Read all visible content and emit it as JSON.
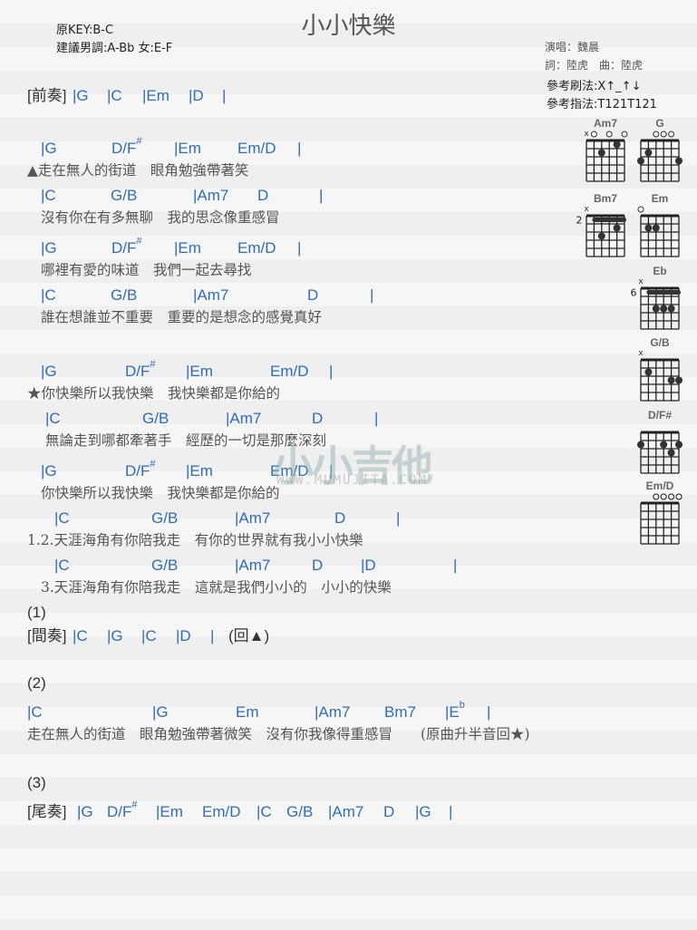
{
  "header": {
    "title": "小小快樂",
    "key": "原KEY:B-C",
    "suggested": "建議男調:A-Bb 女:E-F",
    "singer": "演唱：魏晨",
    "writers": "詞：陸虎　曲：陸虎",
    "strum": "參考刷法:X↑_↑↓",
    "finger": "參考指法:T121T121"
  },
  "colors": {
    "chord": "#2f6db5",
    "lyric": "#555555"
  },
  "watermark": {
    "logo": "小小吉他",
    "url": "WWW.MUMUJITA.COM"
  },
  "lines": [
    {
      "type": "chords",
      "items": [
        {
          "mark": "[前奏]"
        },
        "|G",
        "|C",
        "|Em",
        "|D",
        "|"
      ]
    },
    {
      "type": "chords",
      "items": [
        "|G",
        {
          "c": "D/F",
          "sup": "#"
        },
        "|Em",
        "Em/D",
        "|"
      ]
    },
    {
      "type": "lyric",
      "text": "▲走在無人的街道　眼角勉強帶著笑"
    },
    {
      "type": "chords",
      "items": [
        "|C",
        "G/B",
        "|Am7",
        "D",
        "|"
      ]
    },
    {
      "type": "lyric",
      "text": "沒有你在有多無聊　我的思念像重感冒"
    },
    {
      "type": "chords",
      "items": [
        "|G",
        {
          "c": "D/F",
          "sup": "#"
        },
        "|Em",
        "Em/D",
        "|"
      ]
    },
    {
      "type": "lyric",
      "text": "哪裡有愛的味道　我們一起去尋找"
    },
    {
      "type": "chords",
      "items": [
        "|C",
        "G/B",
        "|Am7",
        "D",
        "|"
      ]
    },
    {
      "type": "lyric",
      "text": "誰在想誰並不重要　重要的是想念的感覺真好"
    },
    {
      "type": "chords",
      "items": [
        "|G",
        {
          "c": "D/F",
          "sup": "#"
        },
        "|Em",
        "Em/D",
        "|"
      ]
    },
    {
      "type": "lyric",
      "text": "★你快樂所以我快樂　我快樂都是你給的"
    },
    {
      "type": "chords",
      "items": [
        "|C",
        "G/B",
        "|Am7",
        "D",
        "|"
      ]
    },
    {
      "type": "lyric",
      "text": "無論走到哪都牽著手　經歷的一切是那麼深刻"
    },
    {
      "type": "chords",
      "items": [
        "|G",
        {
          "c": "D/F",
          "sup": "#"
        },
        "|Em",
        "Em/D",
        "|"
      ]
    },
    {
      "type": "lyric",
      "text": "你快樂所以我快樂　我快樂都是你給的"
    },
    {
      "type": "chords",
      "items": [
        "|C",
        "G/B",
        "|Am7",
        "D",
        "|"
      ]
    },
    {
      "type": "lyric",
      "text": "1.2.天涯海角有你陪我走　有你的世界就有我小小快樂"
    },
    {
      "type": "chords",
      "items": [
        "|C",
        "G/B",
        "|Am7",
        "D",
        "|D",
        "|"
      ]
    },
    {
      "type": "lyric",
      "text": "3.天涯海角有你陪我走　這就是我們小小的　小小的快樂"
    },
    {
      "type": "mark",
      "text": "(1)"
    },
    {
      "type": "chords",
      "items": [
        {
          "mark": "[間奏]"
        },
        "|C",
        "|G",
        "|C",
        "|D",
        "|",
        {
          "mark": "(回▲)"
        }
      ]
    },
    {
      "type": "mark",
      "text": "(2)"
    },
    {
      "type": "chords",
      "items": [
        "|C",
        "|G",
        "Em",
        "|Am7",
        "Bm7",
        {
          "c": "|E",
          "sup": "b"
        },
        "|"
      ]
    },
    {
      "type": "lyric",
      "text": "走在無人的街道　眼角勉強帶著微笑　沒有你我像得重感冒　　(原曲升半音回★)"
    },
    {
      "type": "mark",
      "text": "(3)"
    },
    {
      "type": "chords",
      "items": [
        {
          "mark": "[尾奏]"
        },
        "|G",
        {
          "c": "D/F",
          "sup": "#"
        },
        "|Em",
        "Em/D",
        "|C",
        "G/B",
        "|Am7",
        "D",
        "|G",
        "|"
      ]
    }
  ],
  "diagrams": [
    {
      "name": "Am7",
      "frets": "x02010"
    },
    {
      "name": "G",
      "frets": "320003"
    },
    {
      "name": "Bm7",
      "frets": "x13121",
      "base": "2",
      "barre": 1
    },
    {
      "name": "Em",
      "frets": "022000",
      "openOnly": [
        0
      ]
    },
    {
      "name": "Eb",
      "frets": "x13331",
      "base": "6",
      "barre": 1
    },
    {
      "name": "G/B",
      "frets": "x20033",
      "noOpen": true
    },
    {
      "name": "D/F#",
      "frets": "200232",
      "noOpen": true
    },
    {
      "name": "Em/D",
      "frets": "xx0000",
      "noX": true
    }
  ]
}
